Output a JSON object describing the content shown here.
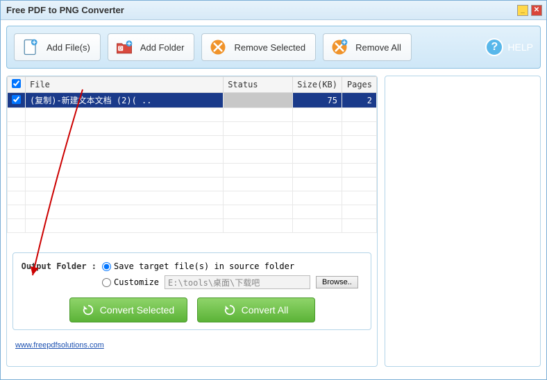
{
  "window": {
    "title": "Free PDF to PNG Converter"
  },
  "toolbar": {
    "add_files": "Add File(s)",
    "add_folder": "Add Folder",
    "remove_selected": "Remove Selected",
    "remove_all": "Remove All",
    "help": "HELP"
  },
  "table": {
    "headers": {
      "file": "File",
      "status": "Status",
      "size": "Size(KB)",
      "pages": "Pages"
    },
    "rows": [
      {
        "checked": true,
        "file": "(复制)-新建文本文档 (2)( ..",
        "status": "",
        "size": "75",
        "pages": "2"
      }
    ]
  },
  "output": {
    "label": "Output Folder :",
    "opt_source": "Save target file(s) in source folder",
    "opt_customize": "Customize",
    "customize_path": "E:\\tools\\桌面\\下载吧",
    "browse": "Browse..",
    "selected": "source"
  },
  "convert": {
    "selected": "Convert Selected",
    "all": "Convert All"
  },
  "footer": {
    "link_text": "www.freepdfsolutions.com"
  }
}
